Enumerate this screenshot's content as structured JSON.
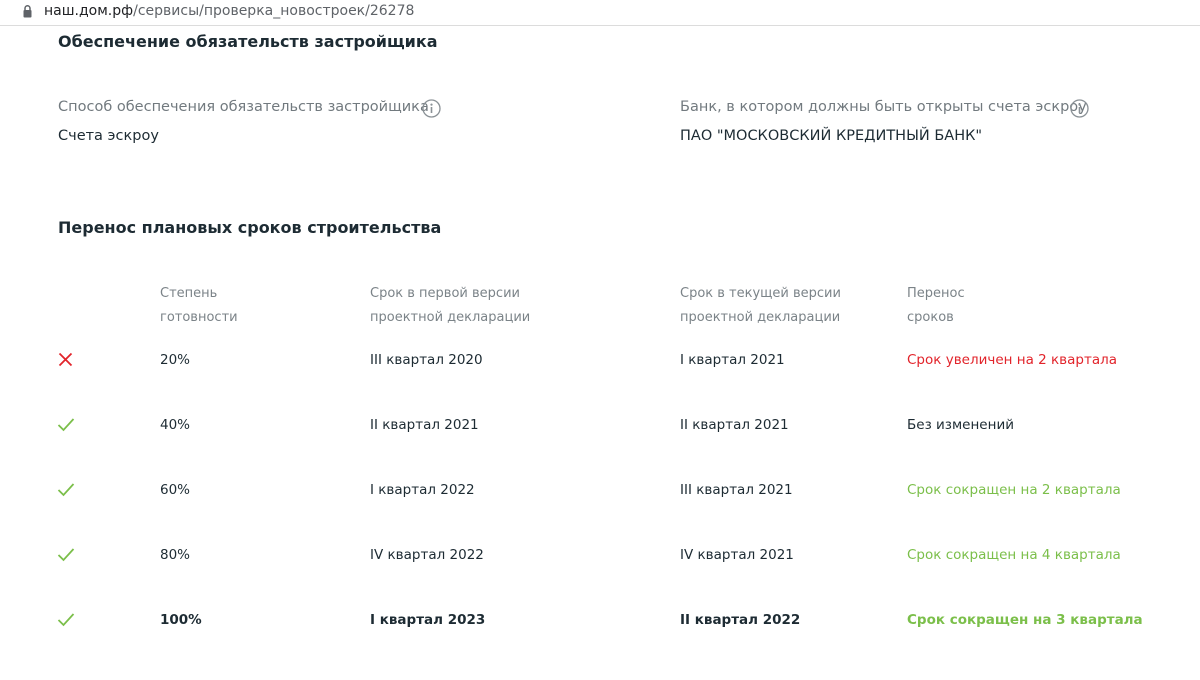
{
  "browser": {
    "url_host": "наш.дом.рф",
    "url_path": "/сервисы/проверка_новостроек/26278"
  },
  "security": {
    "title": "Обеспечение обязательств застройщика",
    "method_label": "Способ обеспечения обязательств застройщика",
    "method_value": "Счета эскроу",
    "bank_label": "Банк, в котором должны быть открыты счета эскроу",
    "bank_value": "ПАО \"МОСКОВСКИЙ КРЕДИТНЫЙ БАНК\""
  },
  "schedule": {
    "title": "Перенос плановых сроков строительства",
    "headers": {
      "readiness_1": "Степень",
      "readiness_2": "готовности",
      "first_1": "Срок в первой версии",
      "first_2": "проектной декларации",
      "current_1": "Срок в текущей версии",
      "current_2": "проектной декларации",
      "shift_1": "Перенос",
      "shift_2": "сроков"
    },
    "colors": {
      "bad": "#e2242b",
      "good": "#7bbf4a",
      "neutral": "#1d2b33"
    },
    "rows": [
      {
        "status": "cross-icon",
        "readiness": "20%",
        "first": "III квартал 2020",
        "current": "I квартал 2021",
        "shift": "Срок увеличен на 2 квартала",
        "shift_status": "bad"
      },
      {
        "status": "check-icon",
        "readiness": "40%",
        "first": "II квартал 2021",
        "current": "II квартал 2021",
        "shift": "Без изменений",
        "shift_status": "neutral"
      },
      {
        "status": "check-icon",
        "readiness": "60%",
        "first": "I квартал 2022",
        "current": "III квартал 2021",
        "shift": "Срок сокращен на 2 квартала",
        "shift_status": "good"
      },
      {
        "status": "check-icon",
        "readiness": "80%",
        "first": "IV квартал 2022",
        "current": "IV квартал 2021",
        "shift": "Срок сокращен на 4 квартала",
        "shift_status": "good"
      },
      {
        "status": "check-icon",
        "readiness": "100%",
        "first": "I квартал 2023",
        "current": "II квартал 2022",
        "shift": "Срок сокращен на 3 квартала",
        "shift_status": "good"
      }
    ]
  }
}
